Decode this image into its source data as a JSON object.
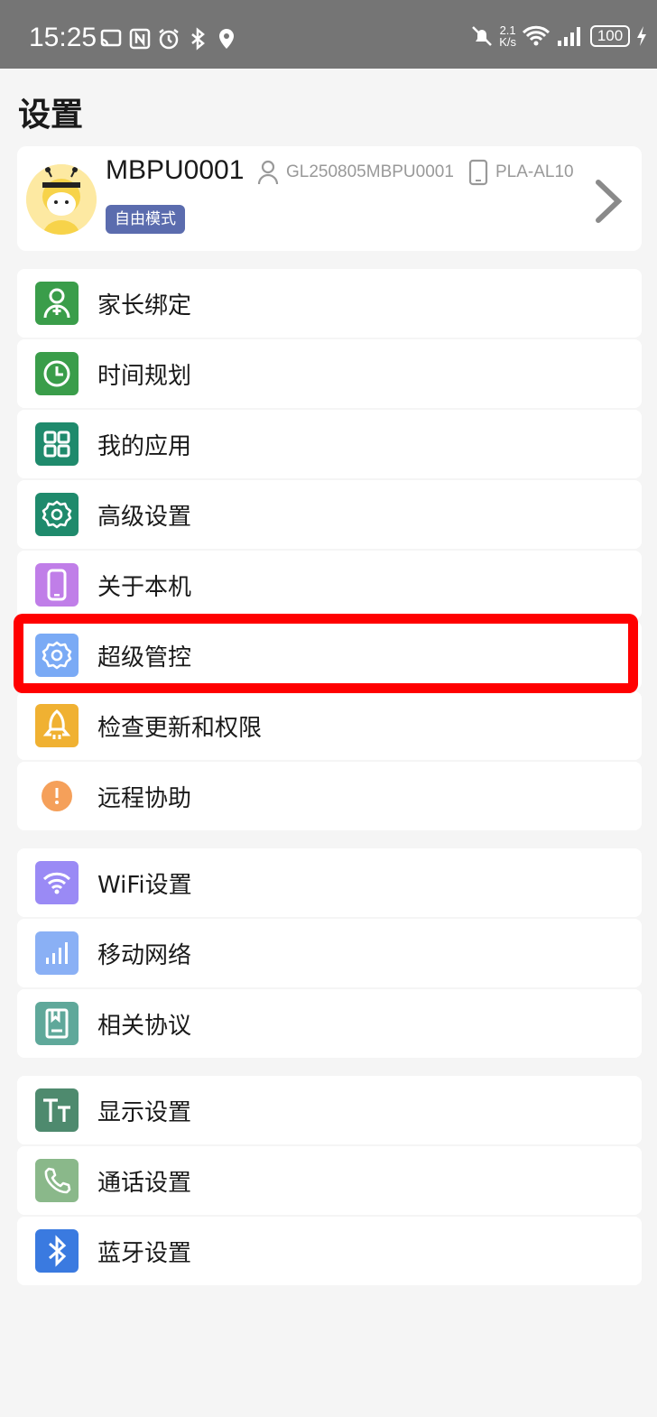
{
  "status_bar": {
    "time": "15:25",
    "net_speed_value": "2.1",
    "net_speed_unit": "K/s",
    "battery": "100",
    "icons": [
      "cast-icon",
      "nfc-icon",
      "alarm-icon",
      "bluetooth-icon",
      "location-icon",
      "mute-icon",
      "wifi-icon",
      "signal-icon",
      "charging-icon"
    ]
  },
  "page": {
    "title": "设置"
  },
  "profile": {
    "name": "MBPU0001",
    "mode_badge": "自由模式",
    "account_id": "GL250805MBPU0001",
    "device_model": "PLA-AL10"
  },
  "menu_groups": [
    [
      {
        "label": "家长绑定",
        "icon": "parent-bind-icon",
        "color": "#3a9d4a"
      },
      {
        "label": "时间规划",
        "icon": "clock-icon",
        "color": "#3a9d4a"
      },
      {
        "label": "我的应用",
        "icon": "apps-grid-icon",
        "color": "#1f8a6c"
      },
      {
        "label": "高级设置",
        "icon": "gear-icon",
        "color": "#1f8a6c"
      },
      {
        "label": "关于本机",
        "icon": "phone-icon",
        "color": "#c07ee8"
      },
      {
        "label": "超级管控",
        "icon": "gear-icon",
        "color": "#7aaaf5"
      },
      {
        "label": "检查更新和权限",
        "icon": "rocket-icon",
        "color": "#f0b132"
      },
      {
        "label": "远程协助",
        "icon": "alert-icon",
        "color": "#f5a05a"
      }
    ],
    [
      {
        "label": "WiFi设置",
        "icon": "wifi-icon",
        "color": "#9a8af5"
      },
      {
        "label": "移动网络",
        "icon": "signal-icon",
        "color": "#8ab0f5"
      },
      {
        "label": "相关协议",
        "icon": "document-icon",
        "color": "#5fa89a"
      }
    ],
    [
      {
        "label": "显示设置",
        "icon": "text-size-icon",
        "color": "#4e8a6e"
      },
      {
        "label": "通话设置",
        "icon": "phone-call-icon",
        "color": "#8ab88a"
      },
      {
        "label": "蓝牙设置",
        "icon": "bluetooth-icon",
        "color": "#3a7ae0"
      }
    ]
  ],
  "highlight": {
    "target": "超级管控",
    "color": "#ff0000"
  }
}
